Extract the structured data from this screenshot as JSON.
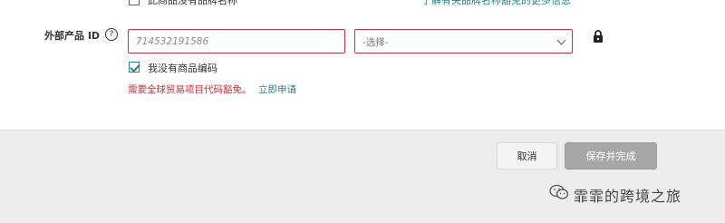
{
  "top_row": {
    "checkbox_label": "此商品没有品牌名称",
    "link_text": "了解有关品牌名称豁免的更多信息"
  },
  "external_id": {
    "label": "外部产品 ID",
    "help_glyph": "?",
    "input_value": "714532191586",
    "select_value": "-选择-",
    "lock_icon": "lock-icon"
  },
  "no_code": {
    "checkbox_label": "我没有商品编码",
    "checked": true
  },
  "notice": {
    "text": "需要全球贸易项目代码豁免。",
    "link": "立即申请"
  },
  "footer": {
    "cancel_label": "取消",
    "save_label": "保存并完成"
  },
  "watermark": {
    "text": "霏霏的跨境之旅",
    "icon": "wechat-icon"
  },
  "colors": {
    "error": "#c8303a",
    "link": "#2f7f86",
    "checkbox": "#2f7f86",
    "save_button": "#a7a7a7"
  }
}
